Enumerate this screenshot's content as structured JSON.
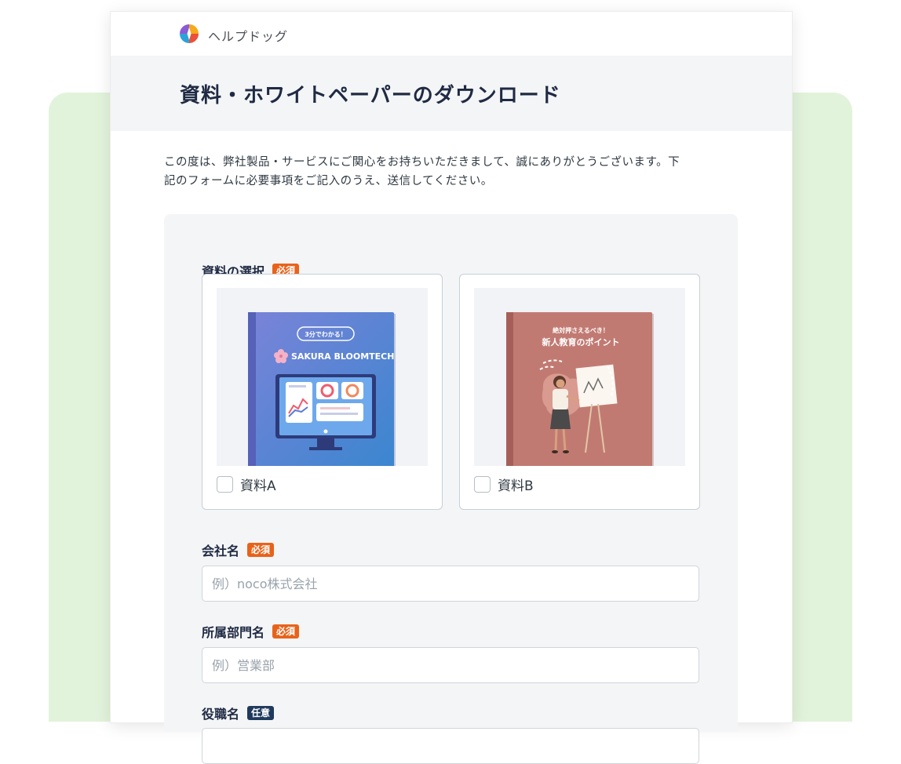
{
  "header": {
    "brand": "ヘルプドッグ",
    "title": "資料・ホワイトペーパーのダウンロード"
  },
  "intro": {
    "line1": "この度は、弊社製品・サービスにご関心をお持ちいただきまして、誠にありがとうございます。下",
    "line2": "記のフォームに必要事項をご記入のうえ、送信してください。"
  },
  "form": {
    "material_select": {
      "label": "資料の選択",
      "badge": "必須",
      "options": [
        {
          "label": "資料A",
          "checked": false,
          "cover": {
            "tag": "3分でわかる！",
            "title": "SAKURA BLOOMTECH",
            "bg_top": "#6f86d6",
            "bg_bottom": "#3e83cf"
          }
        },
        {
          "label": "資料B",
          "checked": false,
          "cover": {
            "subtitle": "絶対押さえるべき！",
            "title": "新人教育のポイント",
            "bg": "#c17a72"
          }
        }
      ]
    },
    "company": {
      "label": "会社名",
      "badge": "必須",
      "placeholder": "例）noco株式会社"
    },
    "department": {
      "label": "所属部門名",
      "badge": "必須",
      "placeholder": "例）営業部"
    },
    "position": {
      "label": "役職名",
      "badge": "任意"
    }
  },
  "colors": {
    "required_badge": "#e8631a",
    "optional_badge": "#1f3a5c",
    "background_accent": "#e2f3db"
  }
}
